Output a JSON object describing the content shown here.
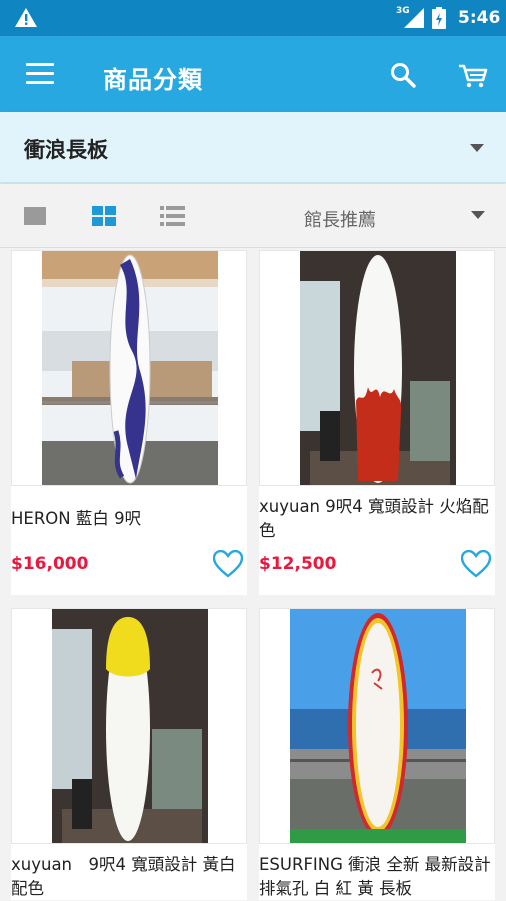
{
  "status_bar": {
    "network": "3G",
    "time": "5:46"
  },
  "app_bar": {
    "title": "商品分類"
  },
  "category": {
    "selected": "衝浪長板"
  },
  "toolbar": {
    "sort_selected": "館長推薦"
  },
  "products": [
    {
      "name": "HERON 藍白 9呎",
      "price": "$16,000"
    },
    {
      "name": "xuyuan 9呎4 寬頭設計 火焰配色",
      "price": "$12,500"
    },
    {
      "name": "xuyuan　9呎4 寬頭設計 黃白配色",
      "price": ""
    },
    {
      "name": "ESURFING 衝浪 全新 最新設計 排氣孔 白 紅 黃 長板",
      "price": ""
    }
  ],
  "colors": {
    "status_bar": "#0f86c2",
    "app_bar": "#28a8e0",
    "price": "#e8183e",
    "accent": "#1e98d6"
  },
  "icons": [
    "warning-icon",
    "signal-icon",
    "battery-icon",
    "menu-icon",
    "search-icon",
    "cart-icon",
    "heart-icon"
  ]
}
